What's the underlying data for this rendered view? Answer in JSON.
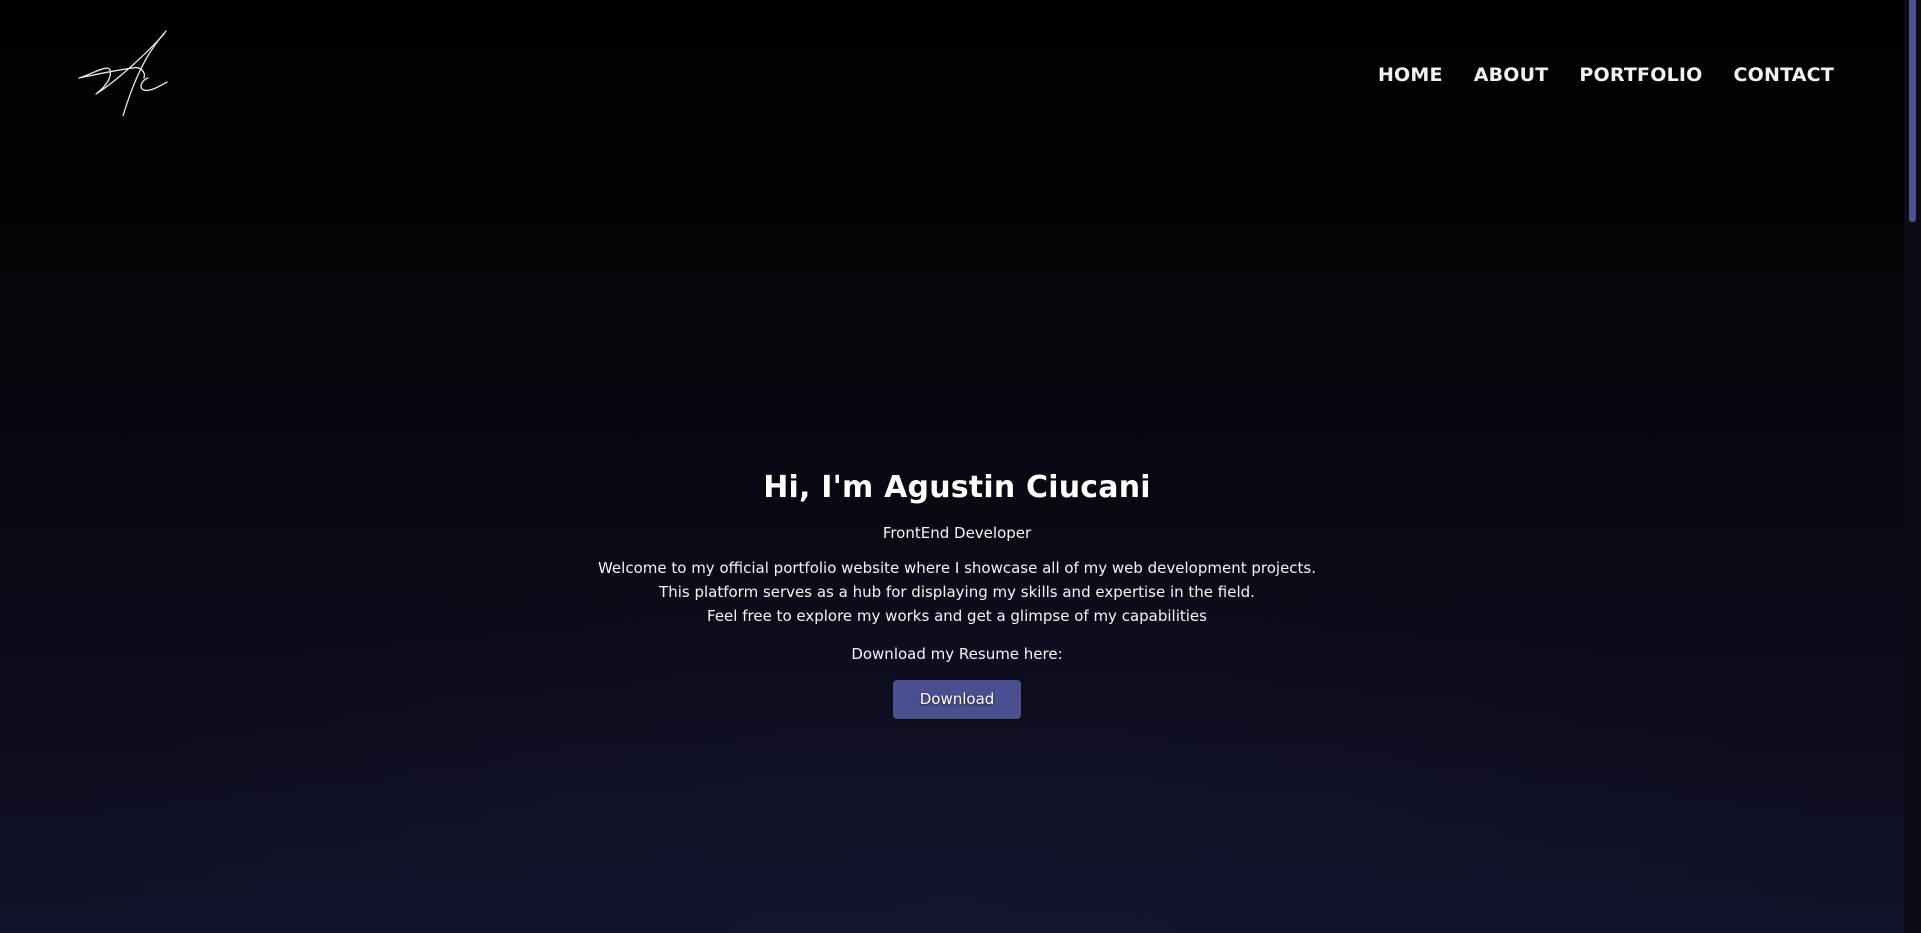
{
  "header": {
    "logo": {
      "icon": "signature-logo-icon",
      "alt_text": "Ac"
    },
    "nav": [
      {
        "label": "HOME"
      },
      {
        "label": "ABOUT"
      },
      {
        "label": "PORTFOLIO"
      },
      {
        "label": "CONTACT"
      }
    ]
  },
  "hero": {
    "title": "Hi, I'm Agustin Ciucani",
    "role": "FrontEnd Developer",
    "intro_lines": [
      "Welcome to my official portfolio website where I showcase all of my web development projects.",
      "This platform serves as a hub for displaying my skills and expertise in the field.",
      "Feel free to explore my works and get a glimpse of my capabilities"
    ],
    "resume_prompt": "Download my Resume here:",
    "download_label": "Download"
  },
  "colors": {
    "background_top": "#000000",
    "background_bottom": "#10122a",
    "accent": "#4b4e8f",
    "text": "#ffffff"
  }
}
